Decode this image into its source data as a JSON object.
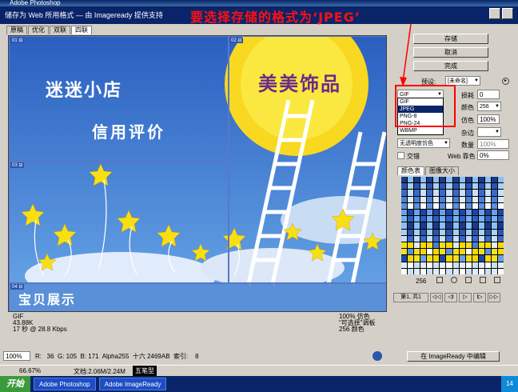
{
  "window": {
    "title": "Adobe Photoshop",
    "subtitle": "储存为 Web 所用格式 — 由 Imageready 提供支持",
    "annotation": "要选择存储的格式为‘JPEG’"
  },
  "tabs": [
    "原稿",
    "优化",
    "双联",
    "四联"
  ],
  "panes": [
    "01 ⊟",
    "02 ⊟",
    "03 ⊟",
    "04 ⊟"
  ],
  "artwork": {
    "title1": "迷迷小店",
    "title2": "信用评价",
    "title3": "美美饰品",
    "title4": "宝贝展示"
  },
  "info_left": [
    "GIF",
    "43.88K",
    "17 秒 @ 28.8 Kbps"
  ],
  "info_right": [
    "100% 仿色",
    "“可选择”调板",
    "256 颜色"
  ],
  "status": {
    "zoom": "100%",
    "readout": "R:   36  G: 105  B: 171  Alpha255  十六 2469AB  索引:    8"
  },
  "buttons": {
    "save": "存储",
    "cancel": "取消",
    "done": "完成",
    "edit_in_imageready": "在 ImageReady 中编辑"
  },
  "settings": {
    "preset_label": "预设:",
    "preset_value": "[未命名]",
    "format_value": "GIF",
    "format_options": [
      "GIF",
      "JPEG",
      "PNG-8",
      "PNG-24",
      "WBMP"
    ],
    "format_highlight": "JPEG",
    "lossy_label": "损耗",
    "lossy_value": "0",
    "colors_label": "颜色",
    "colors_value": "256",
    "dither_label": "仿色",
    "dither_value": "100%",
    "matte_label": "杂边",
    "transparency_dither": "无透明度仿色",
    "amount_label": "数量",
    "amount_value": "100%",
    "interlace_label": "交错",
    "web_snap_label": "Web 靠色",
    "web_snap_value": "0%"
  },
  "panel_tabs": [
    "颜色表",
    "图像大小"
  ],
  "palette": {
    "count": "256",
    "colors": [
      "#1a3a8a",
      "#2a56b0",
      "#3a6ac8",
      "#4a80d8",
      "#5a90e0",
      "#6aa0e8",
      "#7ab0f0",
      "#8ac0f8",
      "#a8d0f8",
      "#c8e0f8",
      "#e0ecfc",
      "#ffffff",
      "#1848a8",
      "#2860c0",
      "#3870d0",
      "#f0e020",
      "#f8d800"
    ]
  },
  "navigation": {
    "page": "第1, 共1",
    "buttons": [
      "◁◁",
      "◁I",
      "▷",
      "I▷",
      "▷▷"
    ]
  },
  "bottom": {
    "zoom": "66.67%",
    "doc": "文档:2.06M/2.24M"
  },
  "taskbar": {
    "start": "开始",
    "tasks": [
      "Adobe Photoshop",
      "Adobe ImageReady",
      "五笔型"
    ],
    "time": "14"
  }
}
